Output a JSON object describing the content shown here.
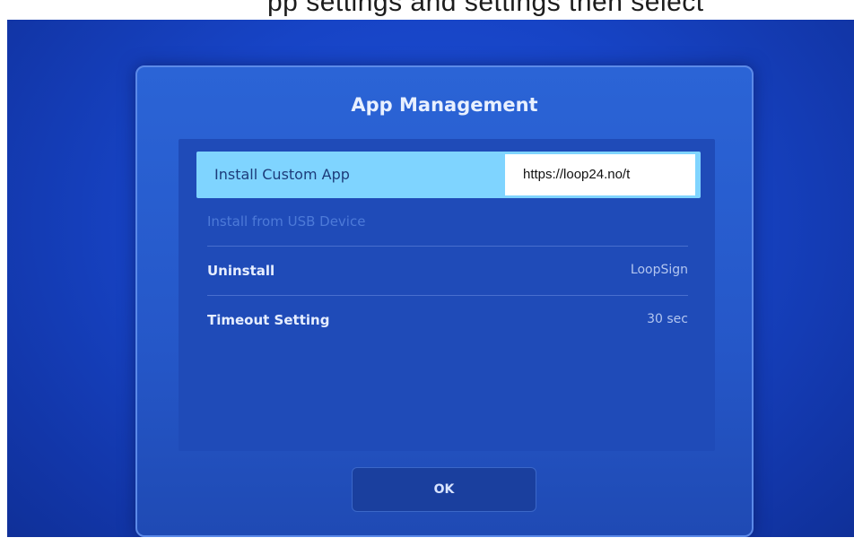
{
  "header": {
    "partial_text": "pp settings and settings then select"
  },
  "dialog": {
    "title": "App Management",
    "items": [
      {
        "label": "Install Custom App",
        "value": "https://loop24.no/t",
        "state": "selected"
      },
      {
        "label": "Install from USB Device",
        "value": "",
        "state": "disabled"
      },
      {
        "label": "Uninstall",
        "value": "LoopSign",
        "state": "normal"
      },
      {
        "label": "Timeout Setting",
        "value": "30 sec",
        "state": "normal"
      }
    ],
    "ok_label": "OK"
  },
  "colors": {
    "background": "#1744c6",
    "dialog": "#2557c8",
    "selected_row": "#7fd4ff",
    "url_field": "#ffffff"
  }
}
